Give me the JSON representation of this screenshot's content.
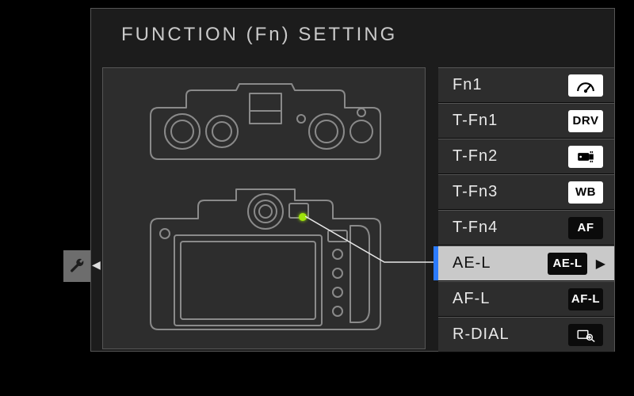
{
  "header": {
    "title": "FUNCTION (Fn) SETTING"
  },
  "list": {
    "items": [
      {
        "label": "Fn1",
        "badge": "gauge-icon",
        "badge_text": "",
        "selected": false
      },
      {
        "label": "T-Fn1",
        "badge": "text",
        "badge_text": "DRV",
        "selected": false
      },
      {
        "label": "T-Fn2",
        "badge": "film-icon",
        "badge_text": "",
        "selected": false
      },
      {
        "label": "T-Fn3",
        "badge": "text",
        "badge_text": "WB",
        "selected": false
      },
      {
        "label": "T-Fn4",
        "badge": "text-dark",
        "badge_text": "AF",
        "selected": false
      },
      {
        "label": "AE-L",
        "badge": "text-dark",
        "badge_text": "AE-L",
        "selected": true
      },
      {
        "label": "AF-L",
        "badge": "text-dark",
        "badge_text": "AF-L",
        "selected": false
      },
      {
        "label": "R-DIAL",
        "badge": "zoom-icon",
        "badge_text": "",
        "selected": false
      }
    ]
  },
  "colors": {
    "highlight_dot": "#9fe40b",
    "selection_bar": "#2b7bff"
  }
}
